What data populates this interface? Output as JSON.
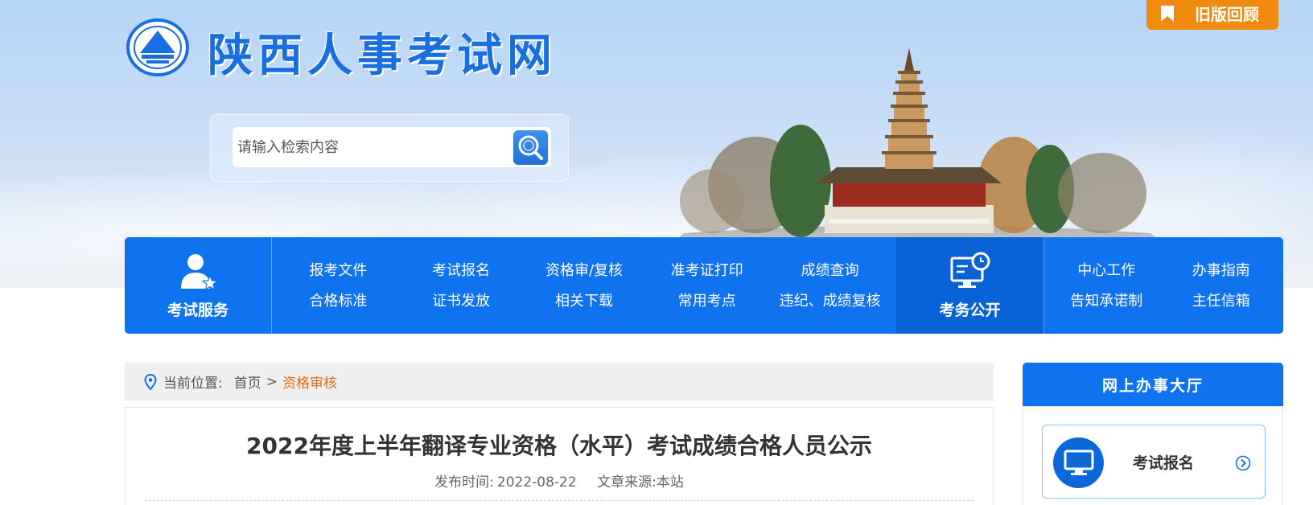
{
  "header": {
    "site_title": "陕西人事考试网",
    "old_version_label": "旧版回顾",
    "search": {
      "placeholder": "请输入检索内容",
      "value": ""
    }
  },
  "nav": {
    "service_title": "考试服务",
    "service_links": [
      "报考文件",
      "考试报名",
      "资格审/复核",
      "准考证打印",
      "成绩查询",
      "合格标准",
      "证书发放",
      "相关下载",
      "常用考点",
      "违纪、成绩复核"
    ],
    "public_title": "考务公开",
    "public_links": [
      "中心工作",
      "办事指南",
      "告知承诺制",
      "主任信箱"
    ]
  },
  "breadcrumb": {
    "prefix": "当前位置:",
    "home": "首页",
    "separator": ">",
    "current": "资格审核"
  },
  "article": {
    "title": "2022年度上半年翻译专业资格（水平）考试成绩合格人员公示",
    "publish_label": "发布时间:",
    "publish_date": "2022-08-22",
    "source_label": "文章来源:",
    "source": "本站"
  },
  "sidebar": {
    "title": "网上办事大厅",
    "cards": [
      {
        "label": "考试报名",
        "icon": "monitor-icon"
      }
    ]
  },
  "colors": {
    "primary_blue": "#0f72ef",
    "accent_orange": "#f18b0f",
    "breadcrumb_current": "#e46a12"
  }
}
